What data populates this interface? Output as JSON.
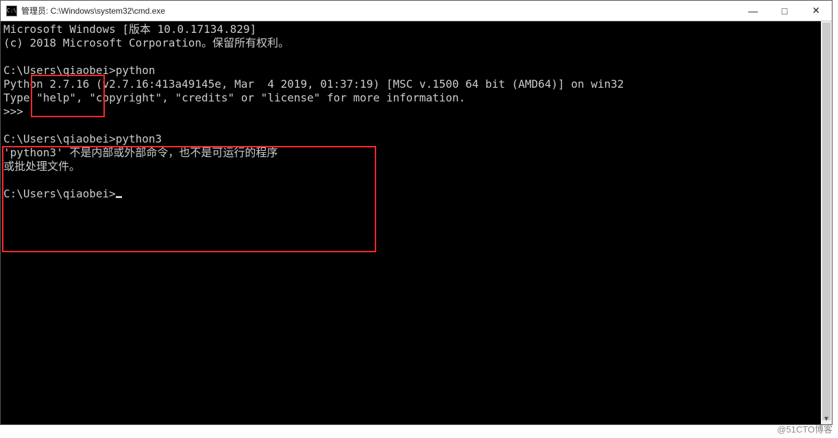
{
  "window": {
    "icon_text": "C:\\",
    "title": "管理员: C:\\Windows\\system32\\cmd.exe",
    "controls": {
      "minimize": "—",
      "maximize": "□",
      "close": "✕"
    }
  },
  "terminal": {
    "lines": [
      "Microsoft Windows [版本 10.0.17134.829]",
      "(c) 2018 Microsoft Corporation。保留所有权利。",
      "",
      "C:\\Users\\qiaobei>python",
      "Python 2.7.16 (v2.7.16:413a49145e, Mar  4 2019, 01:37:19) [MSC v.1500 64 bit (AMD64)] on win32",
      "Type \"help\", \"copyright\", \"credits\" or \"license\" for more information.",
      ">>>",
      "",
      "C:\\Users\\qiaobei>python3",
      "'python3' 不是内部或外部命令，也不是可运行的程序",
      "或批处理文件。",
      "",
      "C:\\Users\\qiaobei>"
    ],
    "cursor_after_last": true
  },
  "watermark": "@51CTO博客"
}
